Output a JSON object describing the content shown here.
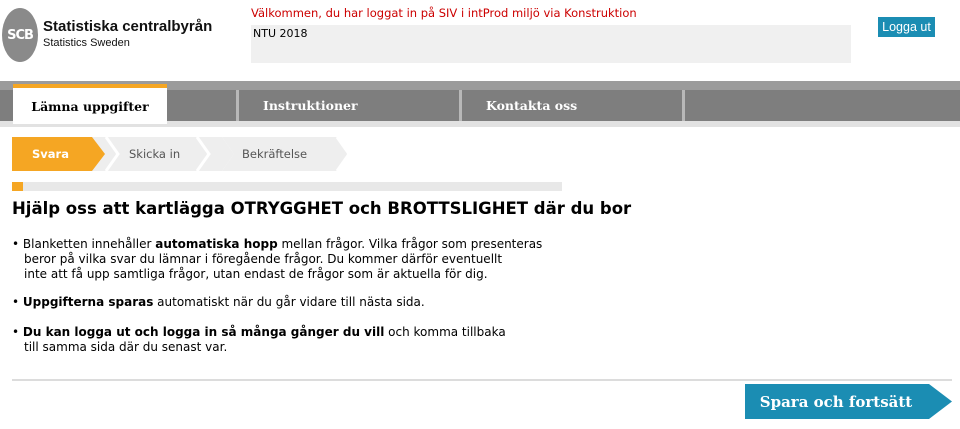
{
  "header": {
    "logo_mark": "SCB",
    "logo_name": "Statistiska centralbyrån",
    "logo_sub": "Statistics Sweden",
    "welcome": "Välkommen, du har loggat in på SIV i intProd miljö via Konstruktion",
    "survey_name": "NTU 2018",
    "logout_label": "Logga ut"
  },
  "nav": {
    "tabs": [
      {
        "label": "Lämna uppgifter",
        "active": true
      },
      {
        "label": "Instruktioner",
        "active": false
      },
      {
        "label": "Kontakta oss",
        "active": false
      }
    ]
  },
  "steps": [
    {
      "label": "Svara",
      "active": true
    },
    {
      "label": "Skicka in",
      "active": false
    },
    {
      "label": "Bekräftelse",
      "active": false
    }
  ],
  "progress": {
    "fraction": 0.02
  },
  "main": {
    "title": "Hjälp oss att kartlägga OTRYGGHET och BROTTSLIGHET där du bor",
    "bullets": {
      "b1_pre": "Blanketten innehåller ",
      "b1_bold": "automatiska hopp",
      "b1_post": " mellan frågor. Vilka frågor som presenteras",
      "b1_line2": "beror på vilka svar du lämnar i föregående frågor. Du kommer därför eventuellt",
      "b1_line3": "inte att få upp samtliga frågor, utan endast de frågor som är aktuella för dig.",
      "b2_bold": "Uppgifterna sparas",
      "b2_post": " automatiskt när du går vidare till nästa sida.",
      "b3_bold": "Du kan logga ut och logga in så många gånger du vill",
      "b3_post": " och komma tillbaka",
      "b3_line2": "till samma sida där du senast var."
    }
  },
  "footer": {
    "save_label": "Spara och fortsätt"
  },
  "colors": {
    "accent": "#f5a623",
    "button": "#1b8db3",
    "nav": "#7e7e7e",
    "error_text": "#cc0000"
  }
}
